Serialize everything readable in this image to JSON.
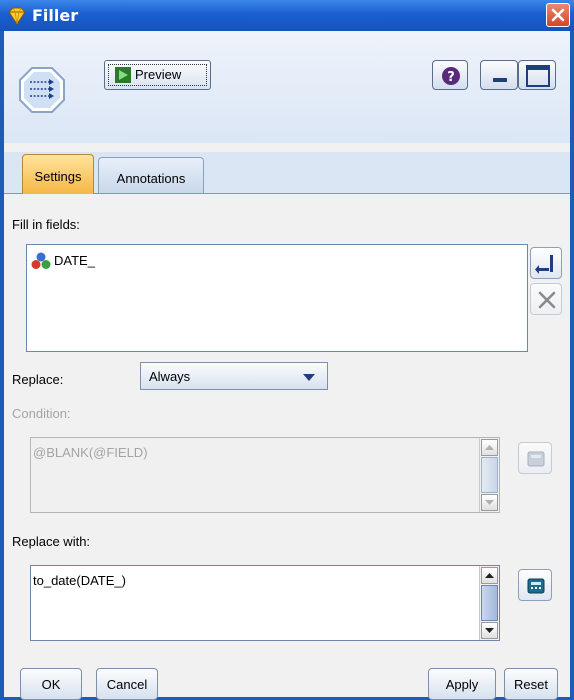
{
  "window": {
    "title": "Filler",
    "close_icon": "close-x"
  },
  "toolbar": {
    "node_icon": "filler-node-icon",
    "preview_label": "Preview",
    "help_icon": "help-icon",
    "minimize_icon": "minimize-icon",
    "maximize_icon": "maximize-icon"
  },
  "tabs": [
    {
      "label": "Settings",
      "active": true
    },
    {
      "label": "Annotations",
      "active": false
    }
  ],
  "settings": {
    "fill_in_fields_label": "Fill in fields:",
    "fields": [
      {
        "name": "DATE_",
        "icon": "set-field-icon"
      }
    ],
    "pick_fields_icon": "field-picker-icon",
    "delete_field_icon": "delete-icon",
    "replace_label": "Replace:",
    "replace_value": "Always",
    "condition_label": "Condition:",
    "condition_value": "@BLANK(@FIELD)",
    "replace_with_label": "Replace with:",
    "replace_with_value": "to_date(DATE_)"
  },
  "footer": {
    "ok": "OK",
    "cancel": "Cancel",
    "apply": "Apply",
    "reset": "Reset"
  },
  "colors": {
    "titlebar": "#1a5fd0",
    "active_tab": "#f4b845",
    "client_bg": "#f1f1f1"
  }
}
